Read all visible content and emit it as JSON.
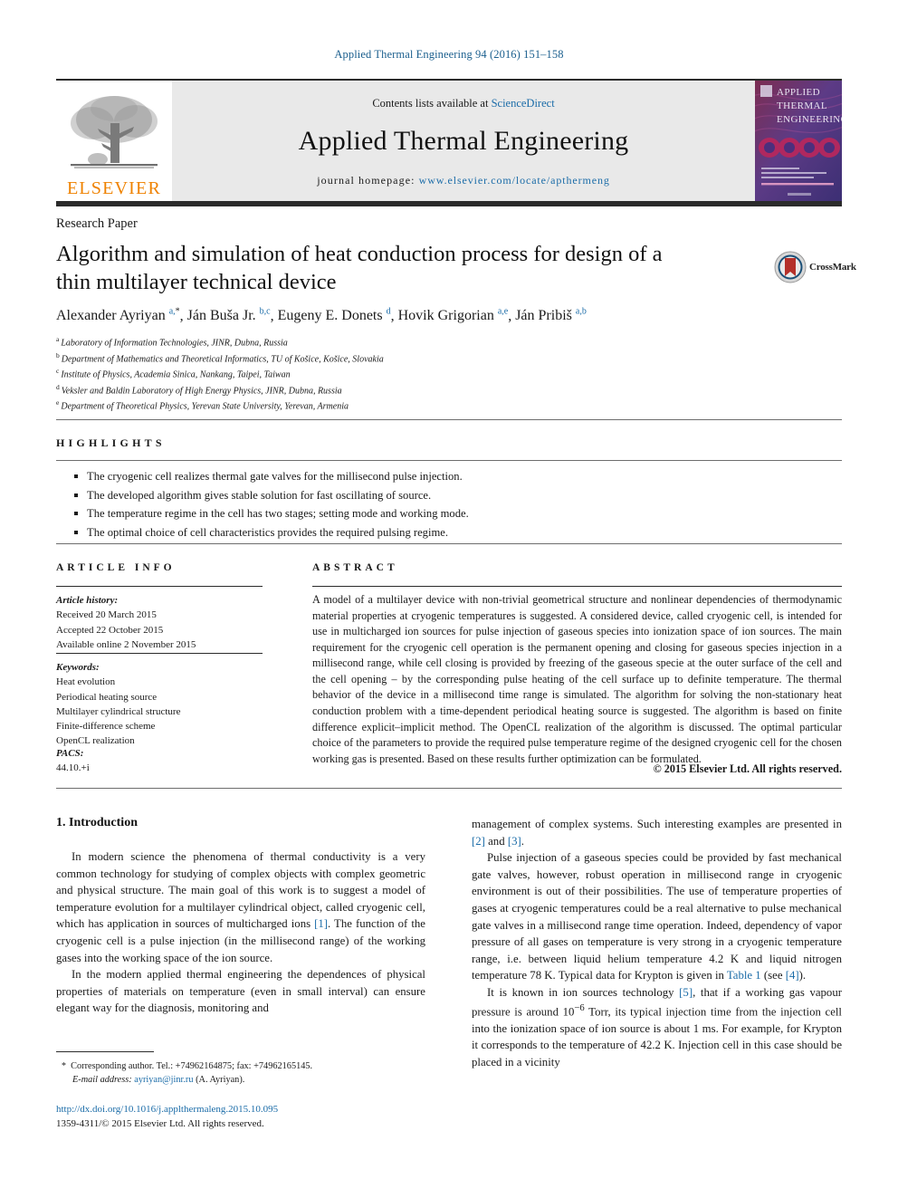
{
  "running_head": "Applied Thermal Engineering 94 (2016) 151–158",
  "masthead": {
    "publisher_name": "ELSEVIER",
    "contents_prefix": "Contents lists available at ",
    "contents_link": "ScienceDirect",
    "journal_title": "Applied Thermal Engineering",
    "homepage_prefix": "journal homepage: ",
    "homepage_url": "www.elsevier.com/locate/apthermeng",
    "cover_title_line1": "APPLIED",
    "cover_title_line2": "THERMAL",
    "cover_title_line3": "ENGINEERING"
  },
  "article": {
    "type": "Research Paper",
    "title": "Algorithm and simulation of heat conduction process for design of a thin multilayer technical device",
    "crossmark_label": "CrossMark"
  },
  "authors": [
    {
      "name": "Alexander Ayriyan",
      "marks": "a,",
      "star": "*"
    },
    {
      "name": "Ján Buša Jr.",
      "marks": "b,c",
      "star": ""
    },
    {
      "name": "Eugeny E. Donets",
      "marks": "d",
      "star": ""
    },
    {
      "name": "Hovik Grigorian",
      "marks": "a,e",
      "star": ""
    },
    {
      "name": "Ján Pribiš",
      "marks": "a,b",
      "star": ""
    }
  ],
  "affiliations": [
    {
      "letter": "a",
      "text": "Laboratory of Information Technologies, JINR, Dubna, Russia"
    },
    {
      "letter": "b",
      "text": "Department of Mathematics and Theoretical Informatics, TU of Košice, Košice, Slovakia"
    },
    {
      "letter": "c",
      "text": "Institute of Physics, Academia Sinica, Nankang, Taipei, Taiwan"
    },
    {
      "letter": "d",
      "text": "Veksler and Baldin Laboratory of High Energy Physics, JINR, Dubna, Russia"
    },
    {
      "letter": "e",
      "text": "Department of Theoretical Physics, Yerevan State University, Yerevan, Armenia"
    }
  ],
  "highlights": {
    "heading": "HIGHLIGHTS",
    "items": [
      "The cryogenic cell realizes thermal gate valves for the millisecond pulse injection.",
      "The developed algorithm gives stable solution for fast oscillating of source.",
      "The temperature regime in the cell has two stages; setting mode and working mode.",
      "The optimal choice of cell characteristics provides the required pulsing regime."
    ]
  },
  "article_info": {
    "heading": "ARTICLE INFO",
    "history_label": "Article history:",
    "received": "Received 20 March 2015",
    "accepted": "Accepted 22 October 2015",
    "available": "Available online 2 November 2015",
    "keywords_label": "Keywords:",
    "keywords": [
      "Heat evolution",
      "Periodical heating source",
      "Multilayer cylindrical structure",
      "Finite-difference scheme",
      "OpenCL realization"
    ],
    "pacs_label": "PACS:",
    "pacs_value": "44.10.+i"
  },
  "abstract": {
    "heading": "ABSTRACT",
    "text": "A model of a multilayer device with non-trivial geometrical structure and nonlinear dependencies of thermodynamic material properties at cryogenic temperatures is suggested. A considered device, called cryogenic cell, is intended for use in multicharged ion sources for pulse injection of gaseous species into ionization space of ion sources. The main requirement for the cryogenic cell operation is the permanent opening and closing for gaseous species injection in a millisecond range, while cell closing is provided by freezing of the gaseous specie at the outer surface of the cell and the cell opening – by the corresponding pulse heating of the cell surface up to definite temperature. The thermal behavior of the device in a millisecond time range is simulated. The algorithm for solving the non-stationary heat conduction problem with a time-dependent periodical heating source is suggested. The algorithm is based on finite difference explicit–implicit method. The OpenCL realization of the algorithm is discussed. The optimal particular choice of the parameters to provide the required pulse temperature regime of the designed cryogenic cell for the chosen working gas is presented. Based on these results further optimization can be formulated.",
    "copyright": "© 2015 Elsevier Ltd. All rights reserved."
  },
  "body": {
    "section_heading": "1. Introduction",
    "left_paragraphs": [
      "In modern science the phenomena of thermal conductivity is a very common technology for studying of complex objects with complex geometric and physical structure. The main goal of this work is to suggest a model of temperature evolution for a multilayer cylindrical object, called cryogenic cell, which has application in sources of multicharged ions [1]. The function of the cryogenic cell is a pulse injection (in the millisecond range) of the working gases into the working space of the ion source.",
      "In the modern applied thermal engineering the dependences of physical properties of materials on temperature (even in small interval) can ensure elegant way for the diagnosis, monitoring and"
    ],
    "right_paragraphs": [
      "management of complex systems. Such interesting examples are presented in [2] and [3].",
      "Pulse injection of a gaseous species could be provided by fast mechanical gate valves, however, robust operation in millisecond range in cryogenic environment is out of their possibilities. The use of temperature properties of gases at cryogenic temperatures could be a real alternative to pulse mechanical gate valves in a millisecond range time operation. Indeed, dependency of vapor pressure of all gases on temperature is very strong in a cryogenic temperature range, i.e. between liquid helium temperature 4.2 K and liquid nitrogen temperature 78 K. Typical data for Krypton is given in Table 1 (see [4]).",
      "It is known in ion sources technology [5], that if a working gas vapour pressure is around 10⁻⁶ Torr, its typical injection time from the injection cell into the ionization space of ion source is about 1 ms. For example, for Krypton it corresponds to the temperature of 42.2 K. Injection cell in this case should be placed in a vicinity"
    ]
  },
  "footnotes": {
    "corresponding": "Corresponding author. Tel.: +74962164875; fax: +74962165145.",
    "email_label": "E-mail address:",
    "email": "ayriyan@jinr.ru",
    "email_suffix": "(A. Ayriyan).",
    "doi": "http://dx.doi.org/10.1016/j.applthermaleng.2015.10.095",
    "issn_line": "1359-4311/© 2015 Elsevier Ltd. All rights reserved."
  },
  "colors": {
    "link_blue": "#1b6ca8",
    "elsevier_orange": "#ef8200",
    "band_gray": "#e9e9e9",
    "rule_dark": "#2b2b2b"
  }
}
